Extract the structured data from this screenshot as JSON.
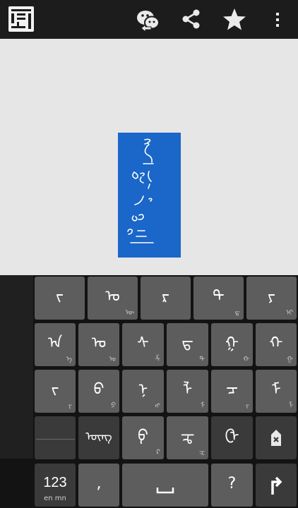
{
  "colors": {
    "action_bar": "#1c1c1c",
    "canvas": "#e6e6e6",
    "text_box": "#1a66c9",
    "keyboard_bg": "#131313",
    "key": "#5d5d5d",
    "key_dark": "#3a3a3a"
  },
  "action_bar": {
    "icons": [
      "app-logo-icon",
      "wechat-share-icon",
      "share-icon",
      "star-icon",
      "overflow-menu-icon"
    ]
  },
  "keyboard": {
    "row1": [
      {
        "main": "ᠵ",
        "sub": ""
      },
      {
        "main": "ᠤ",
        "sub": "ᠥ"
      },
      {
        "main": "ᠷ",
        "sub": ""
      },
      {
        "main": "ᠲ",
        "sub": "ᠳ"
      },
      {
        "main": "ᠶ",
        "sub": "ᠢ"
      }
    ],
    "row2": [
      {
        "main": "ᠠ",
        "sub": "ᠡ"
      },
      {
        "main": "ᠣ",
        "sub": "ᠤ"
      },
      {
        "main": "ᠰ",
        "sub": "ᠱ"
      },
      {
        "main": "ᠳ",
        "sub": "ᠲ"
      },
      {
        "main": "ᠭ",
        "sub": "ᠬ"
      },
      {
        "main": "ᠬ",
        "sub": "ᠭ"
      }
    ],
    "row3": [
      {
        "main": "ᠵ",
        "sub": "ᠶ"
      },
      {
        "main": "ᠪ",
        "sub": "ᠫ"
      },
      {
        "main": "ᠨ",
        "sub": "ᠩ"
      },
      {
        "main": "ᠯ",
        "sub": "ᠮ"
      },
      {
        "main": "ᠴ",
        "sub": "ᠵ"
      },
      {
        "main": "ᠮ",
        "sub": "ᠯ"
      }
    ],
    "row4": [
      {
        "main": "",
        "sub": ""
      },
      {
        "main": "ᠦᠩ",
        "sub": ""
      },
      {
        "main": "ᠹ",
        "sub": "ᠺ"
      },
      {
        "main": "ᠼ",
        "sub": "ᠽ"
      },
      {
        "main": "ᠿ",
        "sub": ""
      },
      {
        "main": "✕",
        "sub": ""
      }
    ],
    "row5": {
      "numbers_label": "123",
      "lang_label": "en mn",
      "comma_label": ",",
      "question_label": "?"
    }
  }
}
